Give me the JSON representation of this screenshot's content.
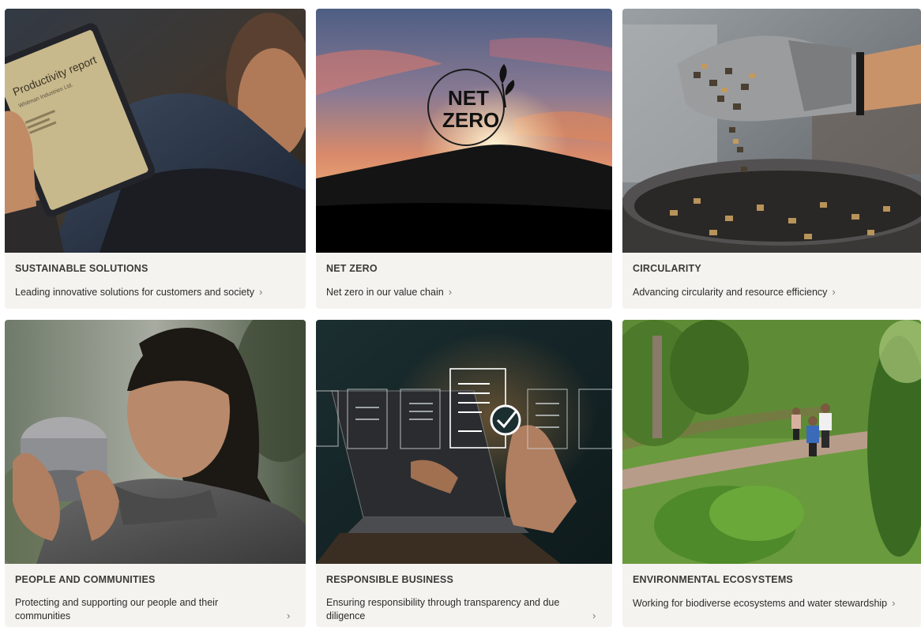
{
  "cards": [
    {
      "title": "SUSTAINABLE SOLUTIONS",
      "description": "Leading innovative solutions for customers and society",
      "image_alt": "Person holding a tablet showing a productivity report",
      "image_text_1": "Productivity report",
      "image_text_2": "Whitman Industries Ltd."
    },
    {
      "title": "NET ZERO",
      "description": "Net zero in our value chain",
      "image_alt": "Sunset over a hill with Net Zero logo",
      "logo_text_1": "NET",
      "logo_text_2": "ZERO"
    },
    {
      "title": "CIRCULARITY",
      "description": "Advancing circularity and resource efficiency",
      "image_alt": "Gloved hand pouring metal inserts into a container"
    },
    {
      "title": "PEOPLE AND COMMUNITIES",
      "description": "Protecting and supporting our people and their communities",
      "image_alt": "Woman holding a metal cup outdoors"
    },
    {
      "title": "RESPONSIBLE BUSINESS",
      "description": "Ensuring responsibility through transparency and due diligence",
      "image_alt": "Hand touching a virtual checkmark above a laptop"
    },
    {
      "title": "ENVIRONMENTAL ECOSYSTEMS",
      "description": "Working for biodiverse ecosystems and water stewardship",
      "image_alt": "Three people standing on a path in a green park"
    }
  ],
  "chevron": "›",
  "colors": {
    "card_bg": "#f5f3f0",
    "title": "#3b3a36",
    "text": "#2c2b28"
  }
}
